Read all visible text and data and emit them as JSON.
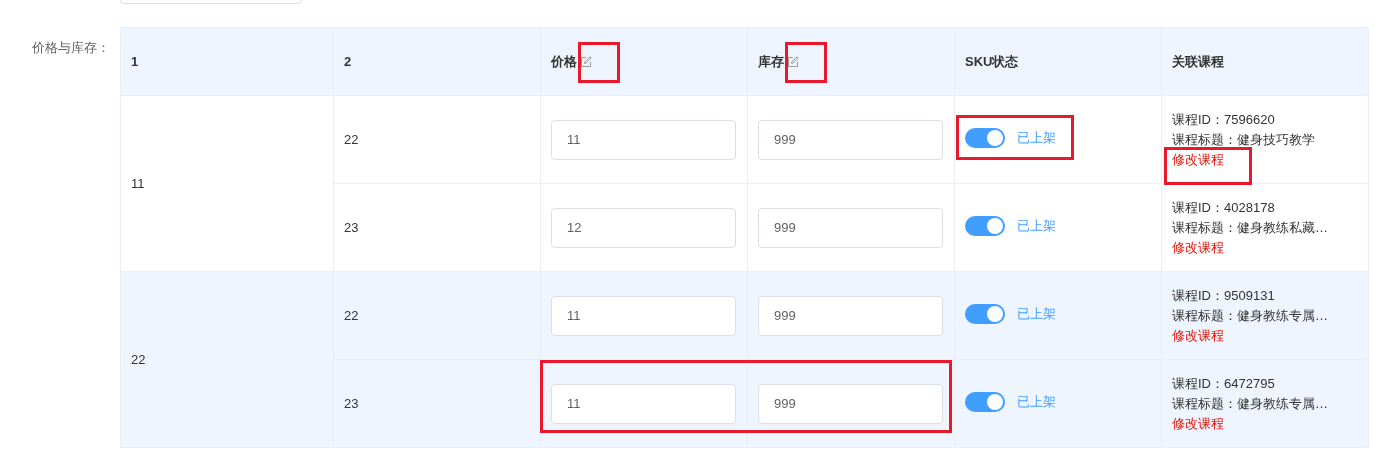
{
  "form_label": "价格与库存：",
  "columns": [
    {
      "label": "1",
      "edit_icon": false,
      "annotated": false
    },
    {
      "label": "2",
      "edit_icon": false,
      "annotated": false
    },
    {
      "label": "价格",
      "edit_icon": true,
      "annotated": true
    },
    {
      "label": "库存",
      "edit_icon": true,
      "annotated": true
    },
    {
      "label": "SKU状态",
      "edit_icon": false,
      "annotated": false
    },
    {
      "label": "关联课程",
      "edit_icon": false,
      "annotated": false
    }
  ],
  "groups": [
    {
      "value": "11",
      "highlighted": false,
      "rows": [
        {
          "value": "22",
          "price": "11",
          "stock": "999",
          "on": true,
          "status": "已上架",
          "course_id": "课程ID：7596620",
          "course_title": "课程标题：健身技巧教学",
          "edit_link": "修改课程",
          "annotated_inputs": false,
          "annotated_status": true,
          "annotated_link": true
        },
        {
          "value": "23",
          "price": "12",
          "stock": "999",
          "on": true,
          "status": "已上架",
          "course_id": "课程ID：4028178",
          "course_title": "课程标题：健身教练私藏…",
          "edit_link": "修改课程",
          "annotated_inputs": false,
          "annotated_status": false,
          "annotated_link": false
        }
      ]
    },
    {
      "value": "22",
      "highlighted": true,
      "rows": [
        {
          "value": "22",
          "price": "11",
          "stock": "999",
          "on": true,
          "status": "已上架",
          "course_id": "课程ID：9509131",
          "course_title": "课程标题：健身教练专属…",
          "edit_link": "修改课程",
          "annotated_inputs": false,
          "annotated_status": false,
          "annotated_link": false
        },
        {
          "value": "23",
          "price": "11",
          "stock": "999",
          "on": true,
          "status": "已上架",
          "course_id": "课程ID：6472795",
          "course_title": "课程标题：健身教练专属…",
          "edit_link": "修改课程",
          "annotated_inputs": true,
          "annotated_status": false,
          "annotated_link": false
        }
      ]
    }
  ]
}
